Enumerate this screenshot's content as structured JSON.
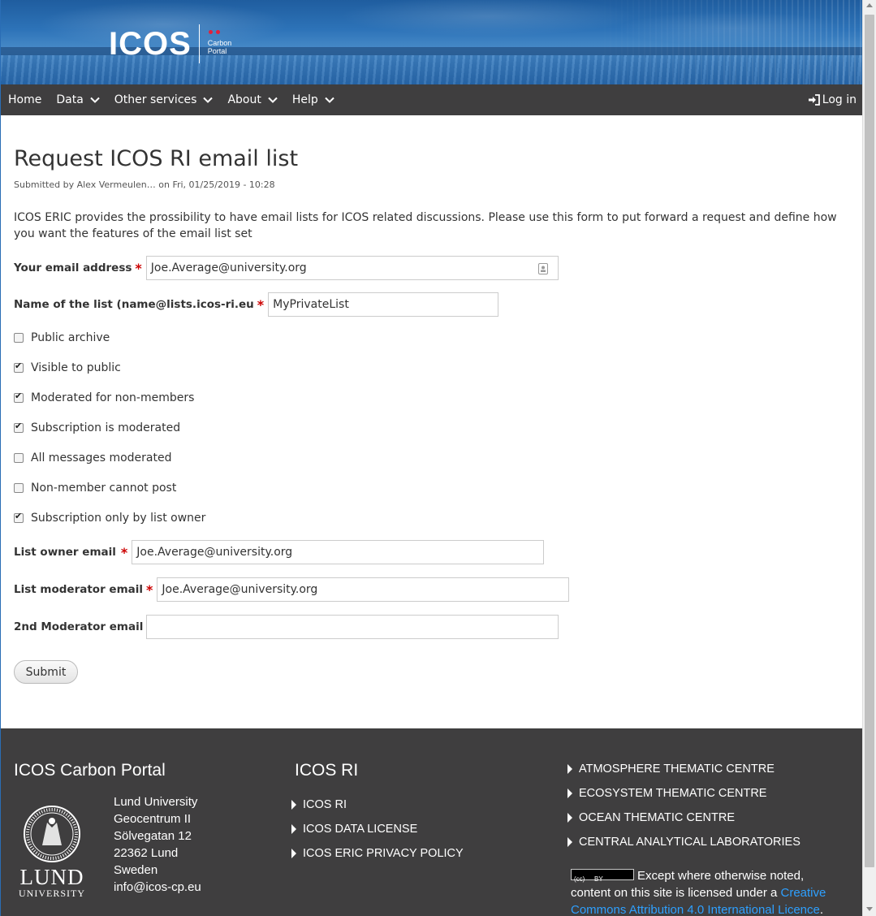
{
  "header": {
    "logo_text": "ICOS",
    "logo_sub_line1": "Carbon",
    "logo_sub_line2": "Portal"
  },
  "nav": {
    "items": [
      {
        "label": "Home",
        "dropdown": false
      },
      {
        "label": "Data",
        "dropdown": true
      },
      {
        "label": "Other services",
        "dropdown": true
      },
      {
        "label": "About",
        "dropdown": true
      },
      {
        "label": "Help",
        "dropdown": true
      }
    ],
    "login_label": "Log in"
  },
  "page": {
    "title": "Request ICOS RI email list",
    "submitted": "Submitted by Alex Vermeulen… on Fri, 01/25/2019 - 10:28",
    "intro": "ICOS ERIC provides the prossibility to have email lists for ICOS related discussions. Please use this form to put forward a request and define how you want the features of the email list set"
  },
  "form": {
    "email": {
      "label": "Your email address",
      "required": "*",
      "value": "Joe.Average@university.org"
    },
    "list_name": {
      "label": "Name of the list (name@lists.icos-ri.eu",
      "required": "*",
      "value": "MyPrivateList"
    },
    "checkboxes": [
      {
        "label": "Public archive",
        "checked": false
      },
      {
        "label": "Visible to public",
        "checked": true
      },
      {
        "label": "Moderated for non-members",
        "checked": true
      },
      {
        "label": "Subscription is moderated",
        "checked": true
      },
      {
        "label": "All messages moderated",
        "checked": false
      },
      {
        "label": "Non-member cannot post",
        "checked": false
      },
      {
        "label": "Subscription only by list owner",
        "checked": true
      }
    ],
    "owner_email": {
      "label": "List owner email",
      "required": "*",
      "value": "Joe.Average@university.org"
    },
    "moderator_email": {
      "label": "List moderator email",
      "required": "*",
      "value": "Joe.Average@university.org"
    },
    "moderator2_email": {
      "label": "2nd Moderator email",
      "value": ""
    },
    "submit_label": "Submit"
  },
  "footer": {
    "col1": {
      "title": "ICOS Carbon Portal",
      "address": [
        "Lund University",
        "Geocentrum II",
        "Sölvegatan 12",
        "22362 Lund",
        "Sweden",
        "info@icos-cp.eu"
      ],
      "logo_word": "LUND",
      "logo_sub": "UNIVERSITY"
    },
    "col2": {
      "title": "ICOS RI",
      "links": [
        "ICOS RI",
        "ICOS DATA LICENSE",
        "ICOS ERIC PRIVACY POLICY"
      ]
    },
    "col3": {
      "links": [
        "ATMOSPHERE THEMATIC CENTRE",
        "ECOSYSTEM THEMATIC CENTRE",
        "OCEAN THEMATIC CENTRE",
        "CENTRAL ANALYTICAL LABORATORIES"
      ],
      "cc_badge": "BY",
      "license_text": "Except where otherwise noted, content on this site is licensed under a",
      "license_link": "Creative Commons Attribution 4.0 International Licence",
      "license_end": "."
    }
  },
  "colors": {
    "nav_bg": "#3f3e3f",
    "required": "#cc0000",
    "link": "#2ea0ff",
    "logo_dots": "#e2203a"
  }
}
